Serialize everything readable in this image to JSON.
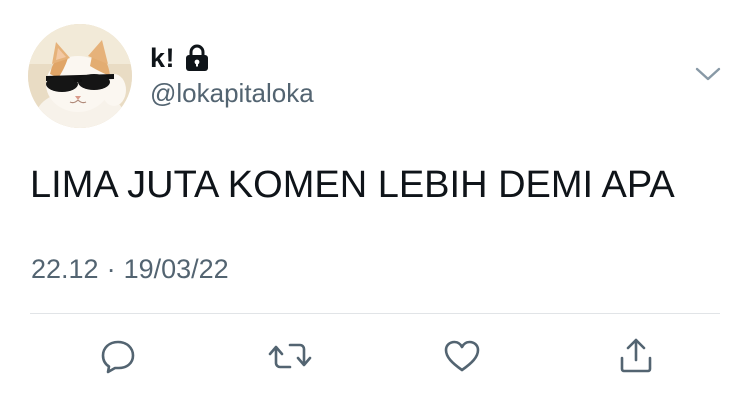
{
  "user": {
    "display_name": "k!",
    "handle": "@lokapitaloka",
    "protected_icon": "lock-icon",
    "avatar_icon": "cat-with-sunglasses-avatar"
  },
  "tweet": {
    "text": "LIMA JUTA KOMEN LEBIH DEMI APA",
    "time": "22.12",
    "separator": "·",
    "date": "19/03/22"
  },
  "menu_icon": "chevron-down-icon",
  "actions": [
    {
      "name": "reply",
      "icon": "speech-bubble-icon"
    },
    {
      "name": "retweet",
      "icon": "retweet-arrows-icon"
    },
    {
      "name": "like",
      "icon": "heart-icon"
    },
    {
      "name": "share",
      "icon": "share-upload-icon"
    }
  ],
  "colors": {
    "text_primary": "#0f1419",
    "text_secondary": "#536471",
    "icon_gray": "#536471",
    "divider": "#e1e4e7"
  }
}
